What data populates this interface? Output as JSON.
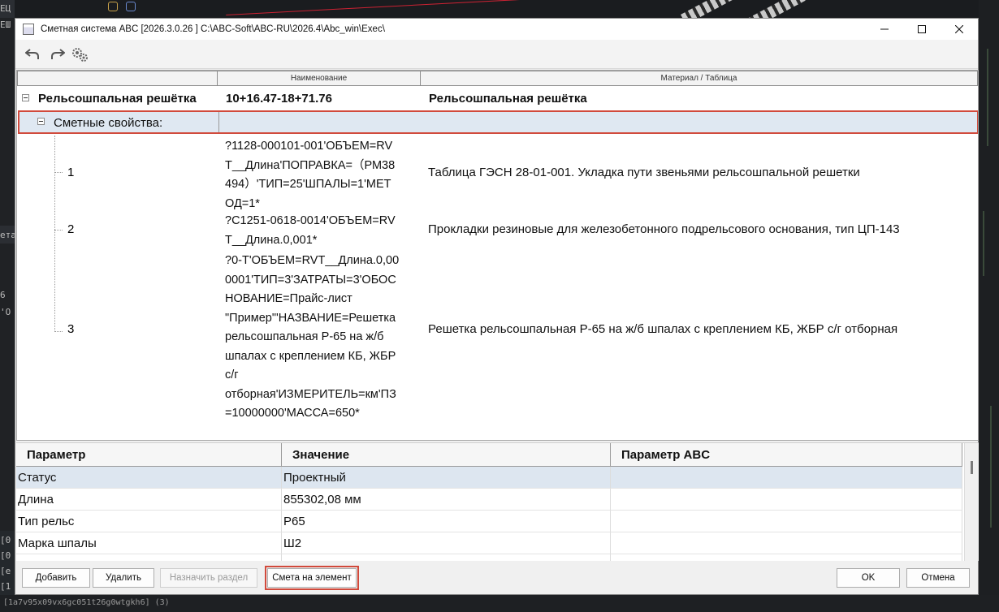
{
  "window": {
    "title": "Сметная система ABC [2026.3.0.26 ]   C:\\ABC-Soft\\ABC-RU\\2026.4\\Abc_win\\Exec\\",
    "controls": {
      "minimize": "—",
      "maximize": "☐",
      "close": "✕"
    }
  },
  "toolbar": {
    "icons": [
      "undo-icon",
      "redo-icon",
      "settings-gears-icon"
    ]
  },
  "tree": {
    "columns": [
      "",
      "Наименование",
      "Материал / Таблица"
    ],
    "root": {
      "label": "Рельсошпальная решётка",
      "name": "10+16.47-18+71.76",
      "material": "Рельсошпальная решётка"
    },
    "group": {
      "label": "Сметные свойства:"
    },
    "items": [
      {
        "num": "1",
        "code": "?1128-000101-001'ОБЪЕМ=RV\nT__Длина'ПОПРАВКА=（РМ38\n494）'ТИП=25'ШПАЛЫ=1'МЕТ\nОД=1*",
        "material": "Таблица ГЭСН 28-01-001. Укладка пути звеньями рельсошпальной решетки"
      },
      {
        "num": "2",
        "code": "?С1251-0618-0014'ОБЪЕМ=RV\nT__Длина.0,001*",
        "material": "Прокладки резиновые для железобетонного подрельсового основания, тип ЦП-143"
      },
      {
        "num": "3",
        "code": "?0-Т'ОБЪЕМ=RVT__Длина.0,00\n0001'ТИП=3'ЗАТРАТЫ=3'ОБОС\nНОВАНИЕ=Прайс-лист\n\"Пример\"'НАЗВАНИЕ=Решетка\nрельсошпальная Р-65 на ж/б\nшпалах с креплением КБ, ЖБР\nс/г\nотборная'ИЗМЕРИТЕЛЬ=км'ПЗ\n=10000000'МАССА=650*",
        "material": "Решетка рельсошпальная Р-65 на ж/б шпалах с креплением КБ, ЖБР с/г отборная"
      }
    ]
  },
  "properties": {
    "headers": [
      "Параметр",
      "Значение",
      "Параметр ABC"
    ],
    "rows": [
      {
        "param": "Статус",
        "value": "Проектный",
        "abc": ""
      },
      {
        "param": "Длина",
        "value": "855302,08  мм",
        "abc": ""
      },
      {
        "param": "Тип рельс",
        "value": "Р65",
        "abc": ""
      },
      {
        "param": "Марка шпалы",
        "value": "Ш2",
        "abc": ""
      }
    ]
  },
  "buttons": {
    "add": "Добавить",
    "delete": "Удалить",
    "assign_section": "Назначить раздел",
    "estimate": "Смета на элемент",
    "ok": "OK",
    "cancel": "Отмена"
  },
  "background": {
    "left_texts": [
      "ЕЦ",
      "ЕШ",
      "ета",
      "6",
      "'О",
      "[0",
      "[0",
      "[е",
      "[1"
    ],
    "bottom_text": "[1a7v95x09vx6gc051t26g0wtgkh6]  (3)"
  },
  "colors": {
    "highlight_outline": "#d14a3c",
    "selected_row": "#dfe8f2"
  }
}
